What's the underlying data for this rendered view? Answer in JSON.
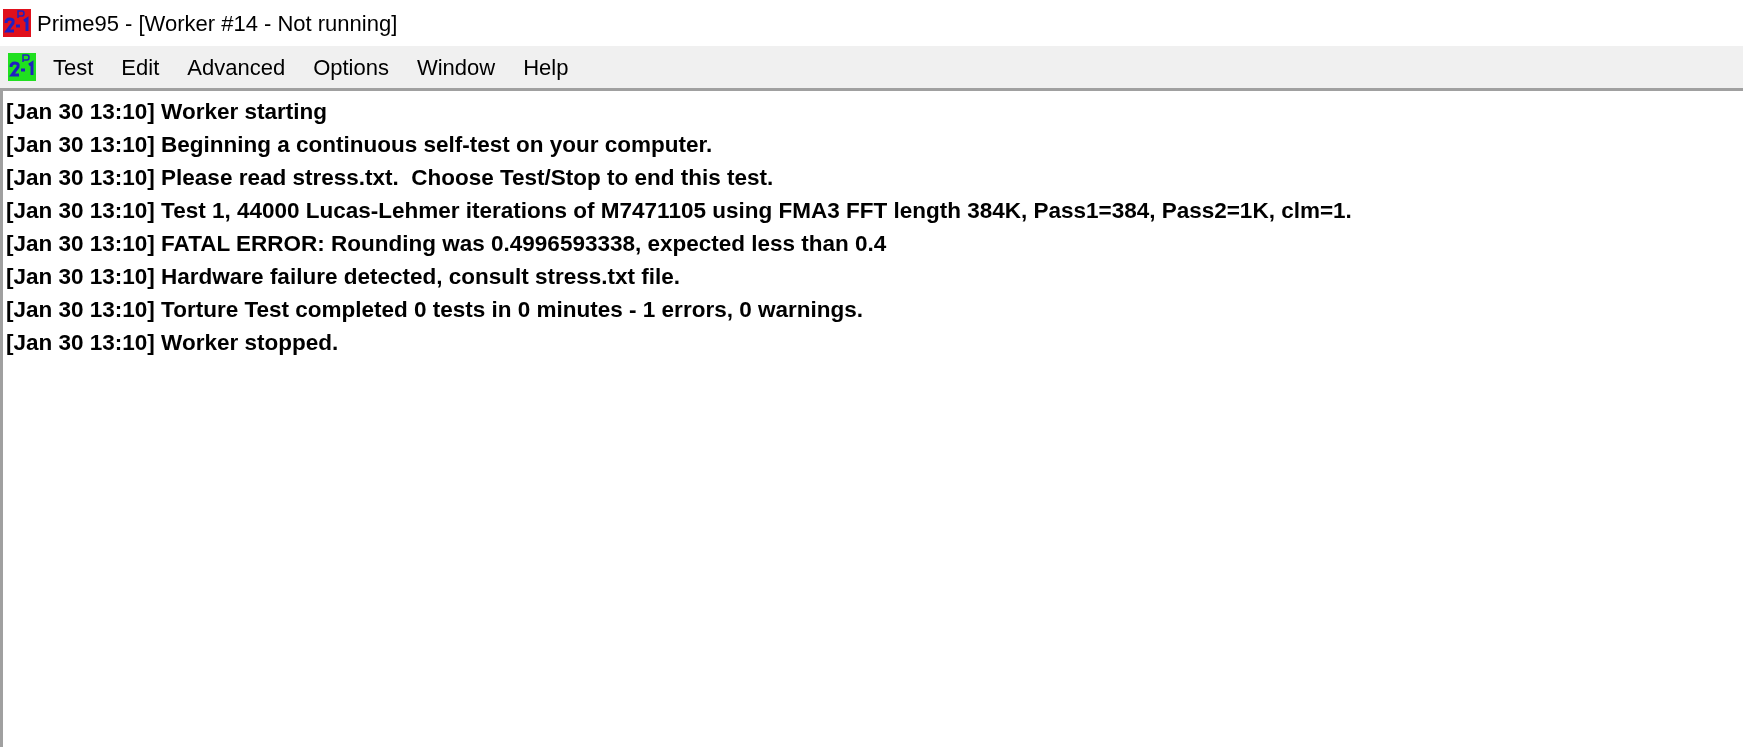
{
  "window": {
    "title": "Prime95 - [Worker #14 - Not running]"
  },
  "menu_bar": {
    "items": [
      "Test",
      "Edit",
      "Advanced",
      "Options",
      "Window",
      "Help"
    ]
  },
  "log": {
    "lines": [
      "[Jan 30 13:10] Worker starting",
      "[Jan 30 13:10] Beginning a continuous self-test on your computer.",
      "[Jan 30 13:10] Please read stress.txt.  Choose Test/Stop to end this test.",
      "[Jan 30 13:10] Test 1, 44000 Lucas-Lehmer iterations of M7471105 using FMA3 FFT length 384K, Pass1=384, Pass2=1K, clm=1.",
      "[Jan 30 13:10] FATAL ERROR: Rounding was 0.4996593338, expected less than 0.4",
      "[Jan 30 13:10] Hardware failure detected, consult stress.txt file.",
      "[Jan 30 13:10] Torture Test completed 0 tests in 0 minutes - 1 errors, 0 warnings.",
      "[Jan 30 13:10] Worker stopped."
    ]
  }
}
